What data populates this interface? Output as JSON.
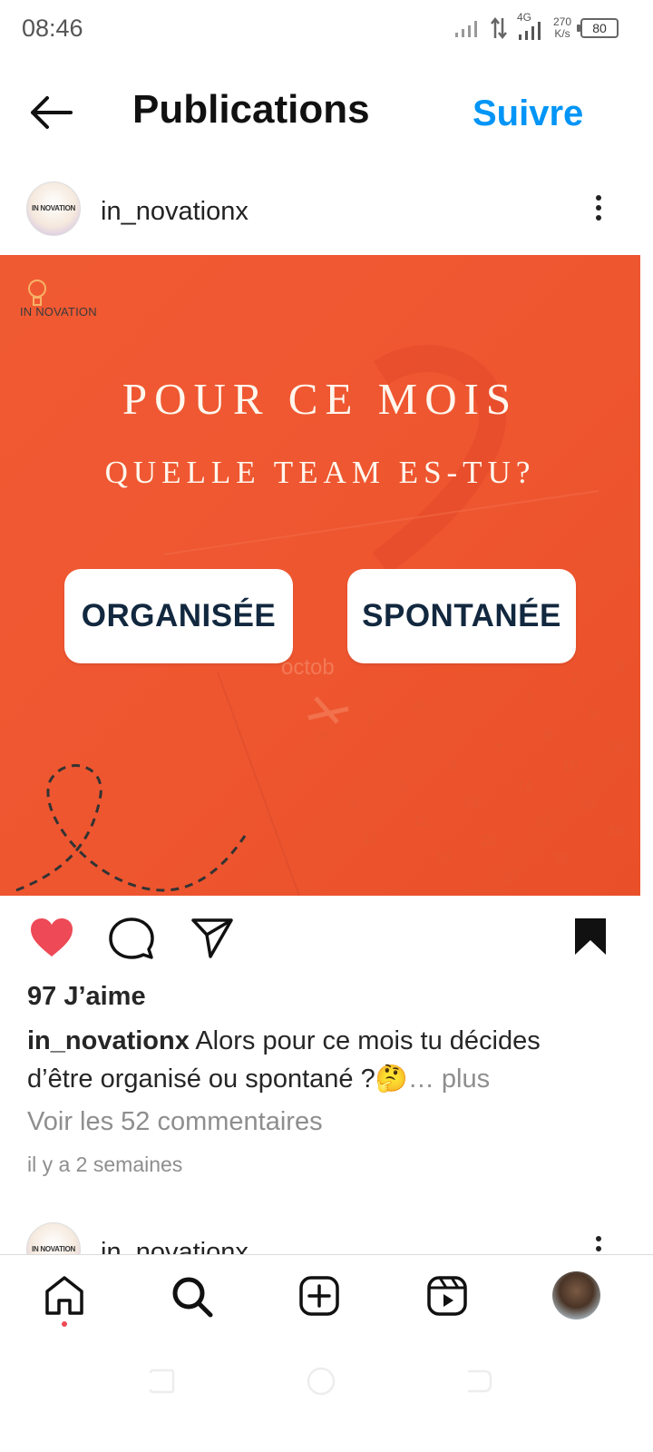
{
  "status_bar": {
    "time": "08:46",
    "network": "4G",
    "speed_value": "270",
    "speed_unit": "K/s",
    "battery": "80"
  },
  "header": {
    "back_icon": "arrow-left-icon",
    "title": "Publications",
    "follow_label": "Suivre"
  },
  "post": {
    "avatar_text": "IN NOVATION",
    "username": "in_novationx",
    "image": {
      "logo_text": "IN NOVATION",
      "headline_1": "POUR CE MOIS",
      "headline_2": "QUELLE TEAM ES-TU?",
      "option_1": "ORGANISÉE",
      "option_2": "SPONTANÉE",
      "background_color": "#ef5631"
    },
    "actions": {
      "liked": true,
      "saved": true
    },
    "likes": "97 J’aime",
    "caption_user": "in_novationx",
    "caption_text": " Alors pour ce mois tu décides d’être organisé ou spontané ?🤔",
    "caption_more": "… plus",
    "comments_link": "Voir les 52 commentaires",
    "timestamp": "il y a 2 semaines"
  },
  "next_post": {
    "avatar_text": "IN NOVATION",
    "username": "in_novationx"
  },
  "colors": {
    "accent": "#0095f6",
    "like": "#ed4956"
  }
}
